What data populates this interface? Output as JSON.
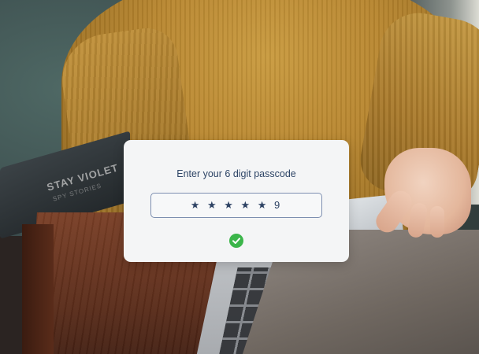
{
  "dialog": {
    "prompt": "Enter your 6 digit passcode",
    "passcode_display": "★ ★ ★ ★ ★ 9",
    "status_icon": "check-circle-icon",
    "status_color": "#3bb54a"
  },
  "background": {
    "book_title": "STAY VIOLET",
    "book_subtitle": "SPY STORIES"
  }
}
